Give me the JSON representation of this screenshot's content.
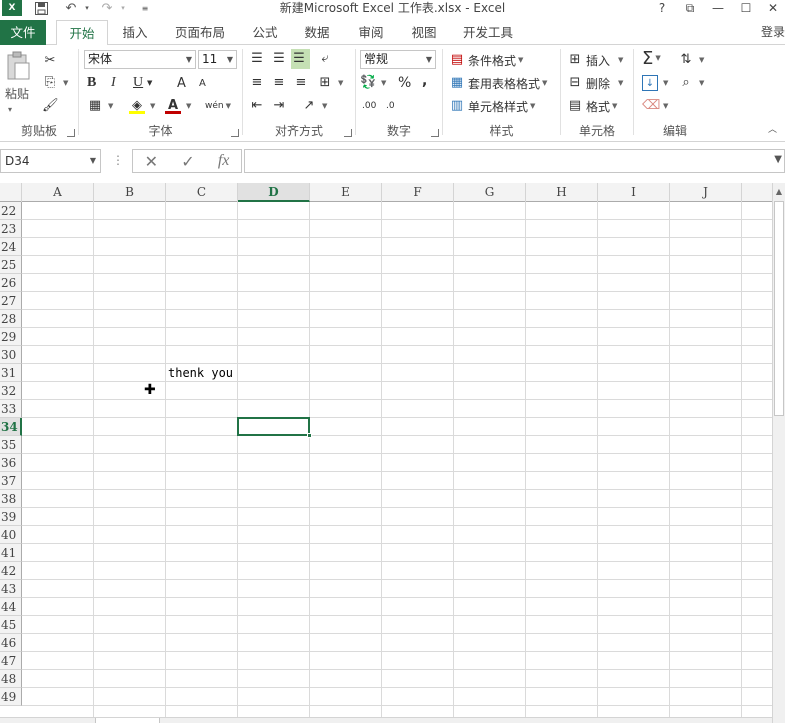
{
  "title_bar": {
    "title": "新建Microsoft Excel 工作表.xlsx - Excel",
    "icons": [
      "excel-logo-icon",
      "save-icon",
      "undo-icon",
      "redo-icon",
      "customize-qat-icon"
    ],
    "window": {
      "help": "?",
      "restore_ribbon": "⧉",
      "minimize": "—",
      "maximize": "☐",
      "close": "✕"
    }
  },
  "ribbon_tabs": {
    "file": "文件",
    "items": [
      "开始",
      "插入",
      "页面布局",
      "公式",
      "数据",
      "审阅",
      "视图",
      "开发工具"
    ],
    "active": "开始",
    "sign_in": "登录"
  },
  "ribbon": {
    "clipboard": {
      "label": "剪贴板",
      "paste": "粘贴"
    },
    "font": {
      "label": "字体",
      "name": "宋体",
      "size": "11",
      "bold": "B",
      "italic": "I",
      "underline": "U",
      "grow": "A",
      "shrink": "A",
      "font_color": "#c00000",
      "fill_color": "#ffff00",
      "phonetic": "wén"
    },
    "alignment": {
      "label": "对齐方式"
    },
    "number": {
      "label": "数字",
      "format": "常规",
      "percent": "%",
      "comma": ",",
      "inc_decimal": ".00",
      "dec_decimal": ".0"
    },
    "styles": {
      "label": "样式",
      "conditional": "条件格式",
      "format_table": "套用表格格式",
      "cell_styles": "单元格样式"
    },
    "cells": {
      "label": "单元格",
      "insert": "插入",
      "delete": "删除",
      "format": "格式"
    },
    "editing": {
      "label": "编辑"
    }
  },
  "formula_bar": {
    "name_box": "D34",
    "formula": "",
    "cancel": "✕",
    "enter": "✓",
    "fx": "fx"
  },
  "grid": {
    "columns": [
      "A",
      "B",
      "C",
      "D",
      "E",
      "F",
      "G",
      "H",
      "I",
      "J"
    ],
    "rows": [
      "22",
      "23",
      "24",
      "25",
      "26",
      "27",
      "28",
      "29",
      "30",
      "31",
      "32",
      "33",
      "34",
      "35",
      "36",
      "37",
      "38",
      "39",
      "40",
      "41",
      "42",
      "43",
      "44",
      "45",
      "46",
      "47",
      "48",
      "49"
    ],
    "selected_column": "D",
    "selected_row": "34",
    "cells": [
      {
        "ref": "C31",
        "value": "thenk you"
      }
    ],
    "accent": "#217346"
  }
}
